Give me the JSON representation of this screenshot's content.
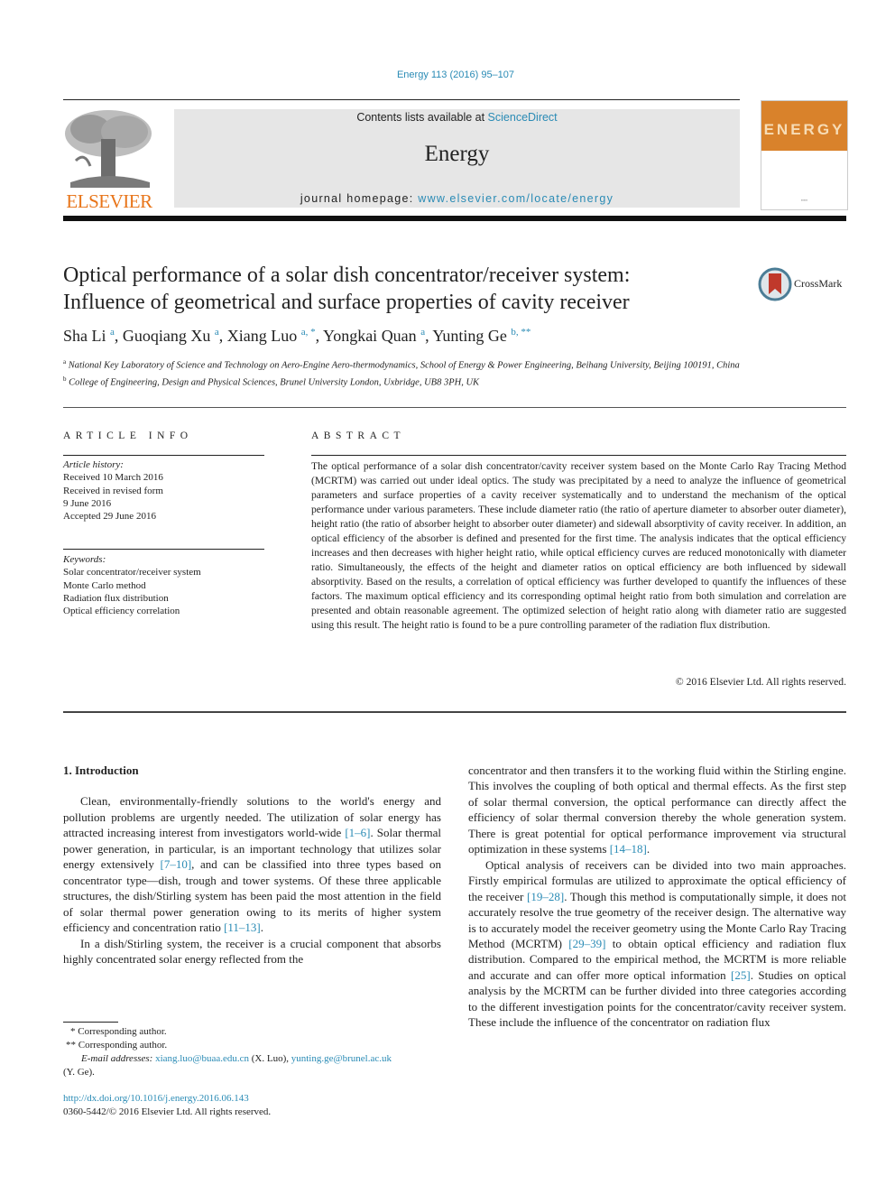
{
  "header": {
    "citation": "Energy 113 (2016) 95–107",
    "contents_prefix": "Contents lists available at ",
    "contents_link": "ScienceDirect",
    "journal_name": "Energy",
    "homepage_prefix": "journal homepage: ",
    "homepage_link": "www.elsevier.com/locate/energy",
    "publisher_logo_text": "ELSEVIER",
    "cover_title": "ENERGY",
    "crossmark_label": "CrossMark",
    "colors": {
      "link": "#2a8bb5",
      "elsevier_orange": "#e8751a",
      "cover_orange": "#d9822b",
      "masthead_bg": "#e6e6e6"
    }
  },
  "article": {
    "title_line1": "Optical performance of a solar dish concentrator/receiver system:",
    "title_line2": "Influence of geometrical and surface properties of cavity receiver",
    "authors": [
      {
        "name": "Sha Li",
        "sup": "a"
      },
      {
        "name": "Guoqiang Xu",
        "sup": "a"
      },
      {
        "name": "Xiang Luo",
        "sup": "a, *"
      },
      {
        "name": "Yongkai Quan",
        "sup": "a"
      },
      {
        "name": "Yunting Ge",
        "sup": "b, **"
      }
    ],
    "affiliations": [
      {
        "sup": "a",
        "text": "National Key Laboratory of Science and Technology on Aero-Engine Aero-thermodynamics, School of Energy & Power Engineering, Beihang University, Beijing 100191, China"
      },
      {
        "sup": "b",
        "text": "College of Engineering, Design and Physical Sciences, Brunel University London, Uxbridge, UB8 3PH, UK"
      }
    ]
  },
  "article_info": {
    "heading": "ARTICLE INFO",
    "history_label": "Article history:",
    "history": [
      "Received 10 March 2016",
      "Received in revised form",
      "9 June 2016",
      "Accepted 29 June 2016"
    ],
    "keywords_label": "Keywords:",
    "keywords": [
      "Solar concentrator/receiver system",
      "Monte Carlo method",
      "Radiation flux distribution",
      "Optical efficiency correlation"
    ]
  },
  "abstract": {
    "heading": "ABSTRACT",
    "text": "The optical performance of a solar dish concentrator/cavity receiver system based on the Monte Carlo Ray Tracing Method (MCRTM) was carried out under ideal optics. The study was precipitated by a need to analyze the influence of geometrical parameters and surface properties of a cavity receiver systematically and to understand the mechanism of the optical performance under various parameters. These include diameter ratio (the ratio of aperture diameter to absorber outer diameter), height ratio (the ratio of absorber height to absorber outer diameter) and sidewall absorptivity of cavity receiver. In addition, an optical efficiency of the absorber is defined and presented for the first time. The analysis indicates that the optical efficiency increases and then decreases with higher height ratio, while optical efficiency curves are reduced monotonically with diameter ratio. Simultaneously, the effects of the height and diameter ratios on optical efficiency are both influenced by sidewall absorptivity. Based on the results, a correlation of optical efficiency was further developed to quantify the influences of these factors. The maximum optical efficiency and its corresponding optimal height ratio from both simulation and correlation are presented and obtain reasonable agreement. The optimized selection of height ratio along with diameter ratio are suggested using this result. The height ratio is found to be a pure controlling parameter of the radiation flux distribution.",
    "copyright": "© 2016 Elsevier Ltd. All rights reserved."
  },
  "body": {
    "section_title": "1.  Introduction",
    "p1": [
      {
        "t": "Clean, environmentally-friendly solutions to the world's energy and pollution problems are urgently needed. The utilization of solar energy has attracted increasing interest from investigators world-wide "
      },
      {
        "ref": "[1–6]"
      },
      {
        "t": ". Solar thermal power generation, in particular, is an important technology that utilizes solar energy extensively "
      },
      {
        "ref": "[7–10]"
      },
      {
        "t": ", and can be classified into three types based on concentrator type—dish, trough and tower systems. Of these three applicable structures, the dish/Stirling system has been paid the most attention in the field of solar thermal power generation owing to its merits of higher system efficiency and concentration ratio "
      },
      {
        "ref": "[11–13]"
      },
      {
        "t": "."
      }
    ],
    "p2_left": "In a dish/Stirling system, the receiver is a crucial component that absorbs highly concentrated solar energy reflected from the",
    "p2_right": [
      {
        "t": "concentrator and then transfers it to the working fluid within the Stirling engine. This involves the coupling of both optical and thermal effects. As the first step of solar thermal conversion, the optical performance can directly affect the efficiency of solar thermal conversion thereby the whole generation system. There is great potential for optical performance improvement via structural optimization in these systems "
      },
      {
        "ref": "[14–18]"
      },
      {
        "t": "."
      }
    ],
    "p3": [
      {
        "t": "Optical analysis of receivers can be divided into two main approaches. Firstly empirical formulas are utilized to approximate the optical efficiency of the receiver "
      },
      {
        "ref": "[19–28]"
      },
      {
        "t": ". Though this method is computationally simple, it does not accurately resolve the true geometry of the receiver design. The alternative way is to accurately model the receiver geometry using the Monte Carlo Ray Tracing Method (MCRTM) "
      },
      {
        "ref": "[29–39]"
      },
      {
        "t": " to obtain optical efficiency and radiation flux distribution. Compared to the empirical method, the MCRTM is more reliable and accurate and can offer more optical information "
      },
      {
        "ref": "[25]"
      },
      {
        "t": ". Studies on optical analysis by the MCRTM can be further divided into three categories according to the different investigation points for the concentrator/cavity receiver system. These include the influence of the concentrator on radiation flux"
      }
    ]
  },
  "footnotes": {
    "corr1": "*  Corresponding author.",
    "corr2": "**  Corresponding author.",
    "email_label": "E-mail addresses:",
    "email1": "xiang.luo@buaa.edu.cn",
    "email1_owner": " (X. Luo), ",
    "email2": "yunting.ge@brunel.ac.uk",
    "email2_owner": "(Y. Ge).",
    "doi": "http://dx.doi.org/10.1016/j.energy.2016.06.143",
    "issn_copyright": "0360-5442/© 2016 Elsevier Ltd. All rights reserved."
  }
}
